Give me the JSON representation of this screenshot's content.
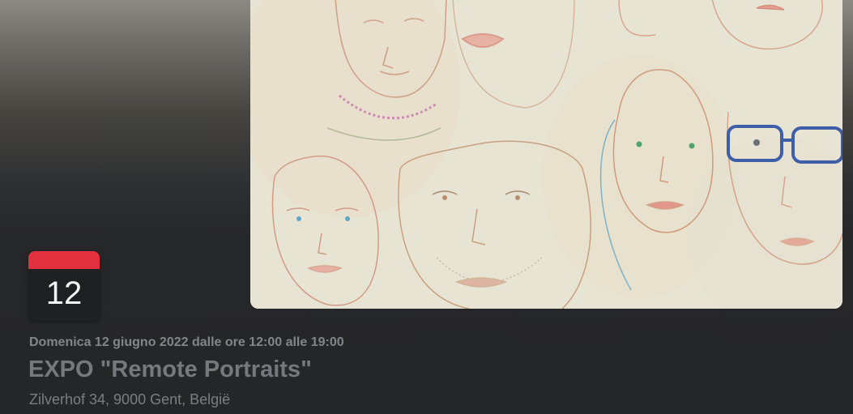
{
  "event": {
    "day_number": "12",
    "date_line": "Domenica 12 giugno 2022 dalle ore 12:00 alle 19:00",
    "title": "EXPO \"Remote Portraits\"",
    "address": "Zilverhof 34, 9000 Gent, België"
  },
  "image": {
    "subject": "watercolor sketch of multiple portrait faces"
  },
  "colors": {
    "calendar_accent": "#e2303f",
    "calendar_body": "#1f2022",
    "background": "#262729",
    "text_muted": "#84858a"
  }
}
